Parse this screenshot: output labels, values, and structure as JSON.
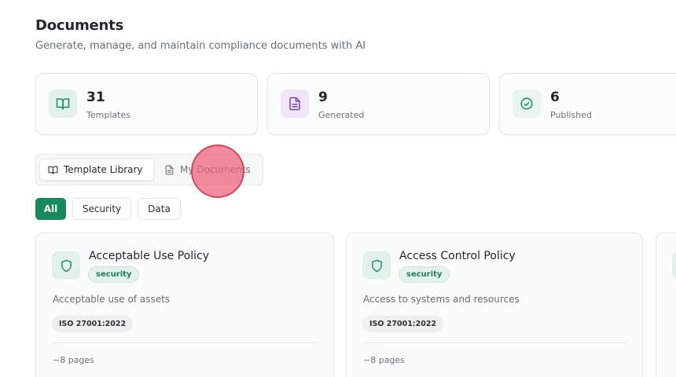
{
  "header": {
    "title": "Documents",
    "subtitle": "Generate, manage, and maintain compliance documents with AI"
  },
  "stats": [
    {
      "value": "31",
      "label": "Templates",
      "icon": "book-open-icon",
      "color": "#1a8a5d",
      "bg": "#e3f1eb"
    },
    {
      "value": "9",
      "label": "Generated",
      "icon": "file-text-icon",
      "color": "#7a3fb3",
      "bg": "#efe6f7"
    },
    {
      "value": "6",
      "label": "Published",
      "icon": "check-circle-icon",
      "color": "#1a8a5d",
      "bg": "#e3f1eb"
    }
  ],
  "tabs": [
    {
      "label": "Template Library",
      "icon": "book-open-icon",
      "active": true
    },
    {
      "label": "My Documents",
      "icon": "file-icon",
      "active": false
    }
  ],
  "filters": [
    {
      "label": "All",
      "active": true
    },
    {
      "label": "Security",
      "active": false
    },
    {
      "label": "Data",
      "active": false
    }
  ],
  "templates": [
    {
      "title": "Acceptable Use Policy",
      "category": "security",
      "description": "Acceptable use of assets",
      "standard": "ISO 27001:2022",
      "pages": "~8 pages",
      "icon": "shield-icon"
    },
    {
      "title": "Access Control Policy",
      "category": "security",
      "description": "Access to systems and resources",
      "standard": "ISO 27001:2022",
      "pages": "~8 pages",
      "icon": "shield-icon"
    }
  ],
  "colors": {
    "accent": "#158a5c",
    "badge_bg": "#e4f2eb",
    "badge_text": "#1c7f55"
  }
}
